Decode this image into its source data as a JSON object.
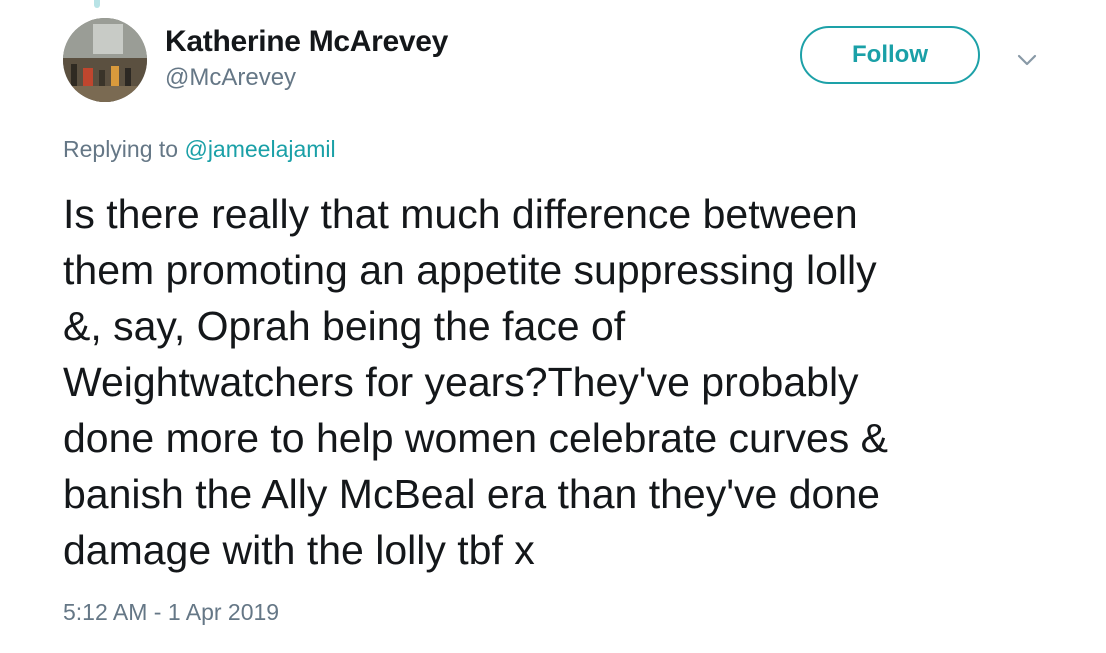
{
  "author": {
    "display_name": "Katherine McArevey",
    "handle": "@McArevey"
  },
  "follow_label": "Follow",
  "reply": {
    "prefix": "Replying to ",
    "mention": "@jameelajamil"
  },
  "tweet_text": "Is there really that much difference between\nthem promoting an appetite suppressing lolly\n&, say, Oprah being the face of\nWeightwatchers for years?They've probably\ndone more to help women celebrate curves &\nbanish the Ally McBeal era than they've done\ndamage with the lolly tbf x",
  "timestamp": "5:12 AM - 1 Apr 2019",
  "colors": {
    "accent": "#1aa0a7",
    "secondary_text": "#657786",
    "primary_text": "#14171a"
  },
  "icons": {
    "caret": "chevron-down-icon",
    "avatar": "profile-photo"
  }
}
